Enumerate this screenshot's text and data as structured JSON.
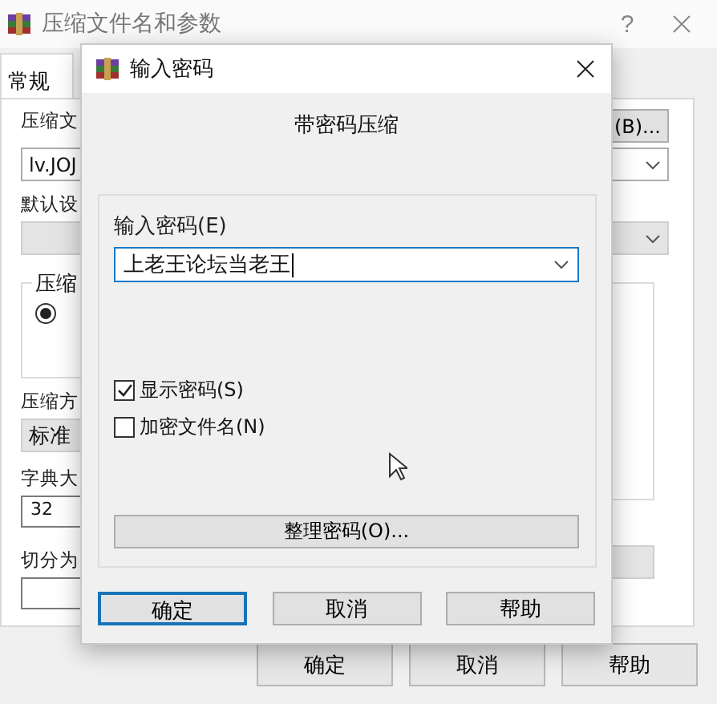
{
  "window": {
    "title": "压缩文件名和参数",
    "help": "?"
  },
  "tabs": [
    {
      "label": "常规",
      "selected": true
    }
  ],
  "form": {
    "archive_label": "压缩文",
    "archive_value": "lv.JOJ",
    "browse_button": "(B)...",
    "profile_label": "默认设",
    "format_group": "压缩",
    "format_radios": [
      {
        "selected": true
      }
    ],
    "method_label": "压缩方",
    "method_value": "标准",
    "dict_label": "字典大",
    "dict_value": "32",
    "split_label": "切分为"
  },
  "buttons": [
    {
      "label": "确定"
    },
    {
      "label": "取消"
    },
    {
      "label": "帮助"
    }
  ],
  "dialog": {
    "title": "输入密码",
    "heading": "带密码压缩",
    "password_label": "输入密码(E)",
    "password_value": "上老王论坛当老王",
    "options": [
      {
        "label": "显示密码(S)",
        "checked": true
      },
      {
        "label": "加密文件名(N)",
        "checked": false
      }
    ],
    "organize_button": "整理密码(O)...",
    "buttons": [
      {
        "label": "确定",
        "default": true
      },
      {
        "label": "取消",
        "default": false
      },
      {
        "label": "帮助",
        "default": false
      }
    ]
  }
}
